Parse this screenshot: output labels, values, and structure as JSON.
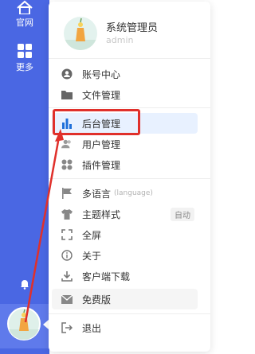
{
  "sidebar": {
    "home_label": "官网",
    "more_label": "更多"
  },
  "user": {
    "name": "系统管理员",
    "role": "admin"
  },
  "menu": {
    "items": [
      {
        "label": "账号中心",
        "icon": "user-circle-icon"
      },
      {
        "label": "文件管理",
        "icon": "folder-icon"
      },
      {
        "label": "后台管理",
        "icon": "bar-chart-icon",
        "active": true
      },
      {
        "label": "用户管理",
        "icon": "users-icon"
      },
      {
        "label": "插件管理",
        "icon": "plugin-grid-icon"
      },
      {
        "label": "多语言",
        "sub": "(language)",
        "icon": "flag-icon"
      },
      {
        "label": "主题样式",
        "badge": "自动",
        "icon": "shirt-icon"
      },
      {
        "label": "全屏",
        "icon": "fullscreen-icon"
      },
      {
        "label": "关于",
        "icon": "info-icon"
      },
      {
        "label": "客户端下载",
        "icon": "download-icon"
      },
      {
        "label": "免费版",
        "icon": "envelope-icon"
      },
      {
        "label": "退出",
        "icon": "logout-icon"
      }
    ]
  },
  "colors": {
    "sidebar": "#4a67e3",
    "accent": "#1e6fd9",
    "highlight": "#e0302b"
  }
}
